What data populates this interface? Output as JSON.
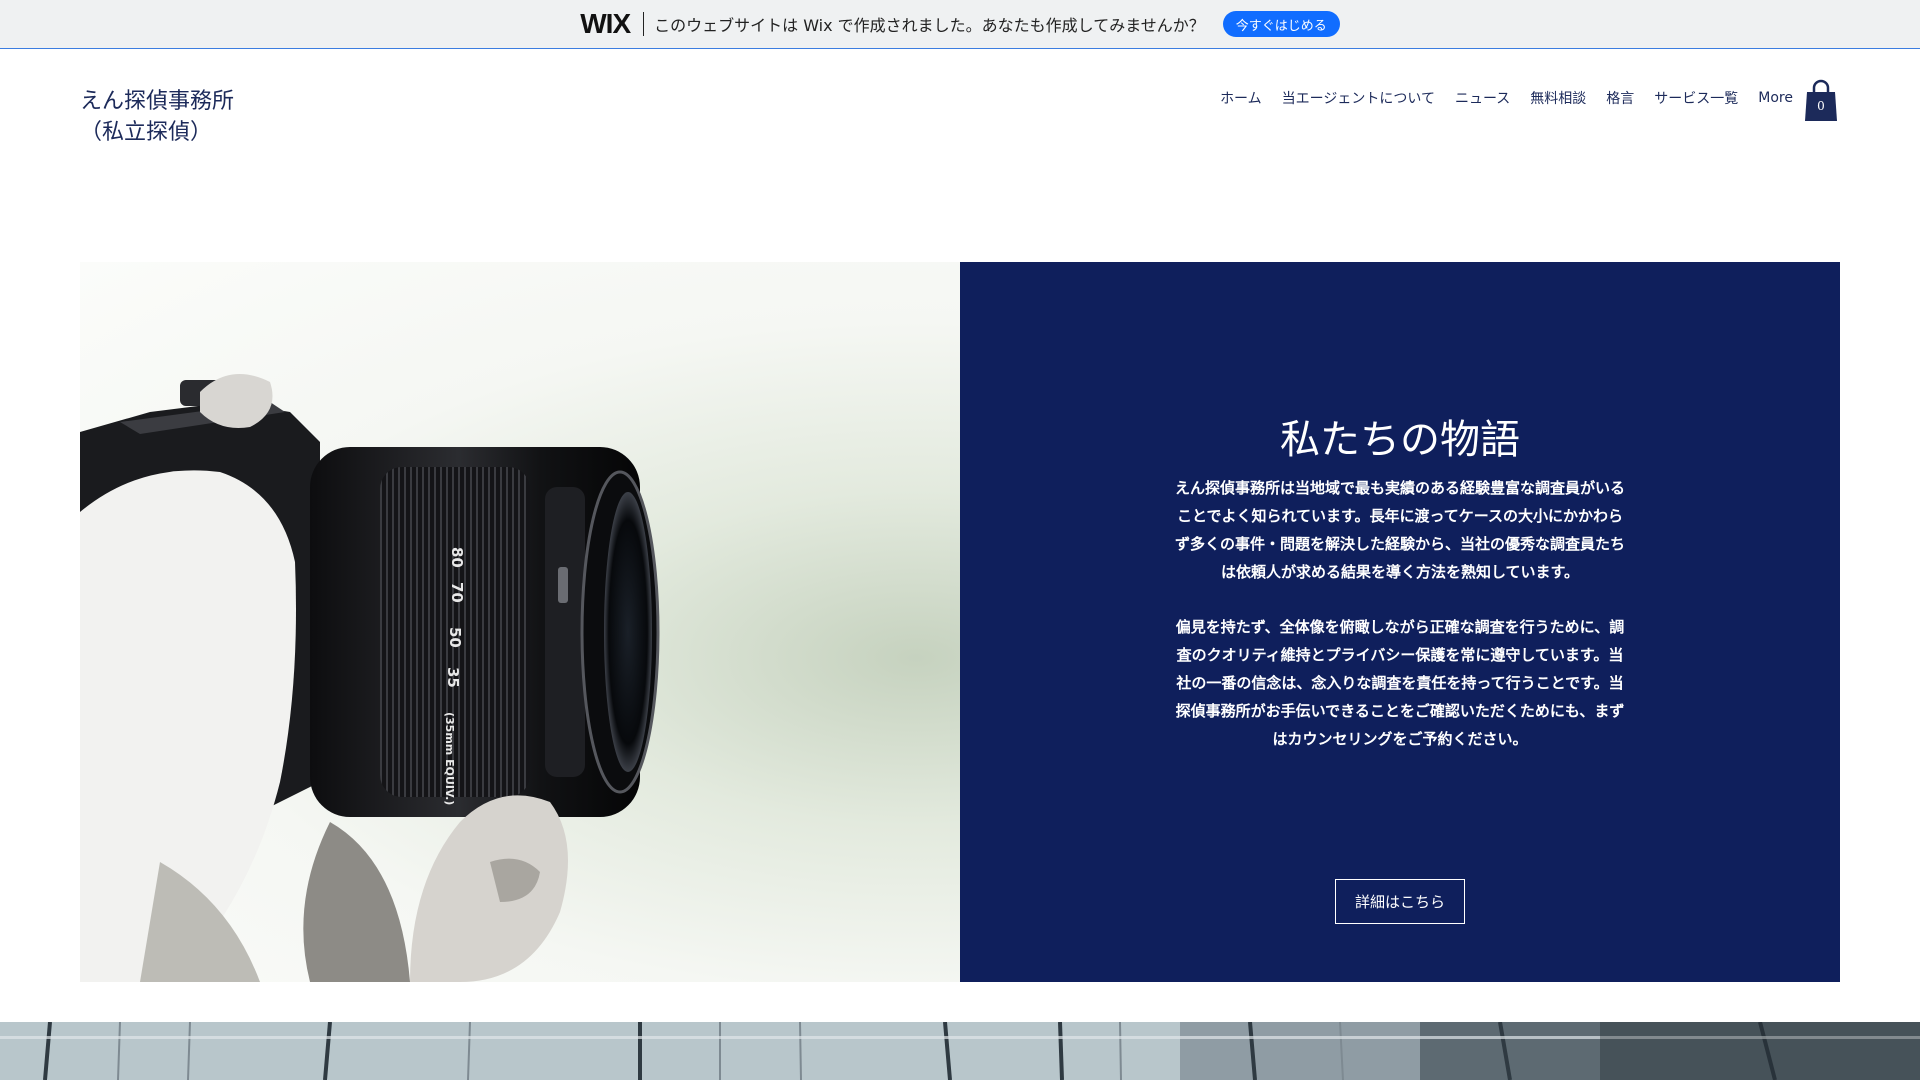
{
  "wix_banner": {
    "logo": "WIX",
    "text": "このウェブサイトは Wix で作成されました。あなたも作成してみませんか？",
    "cta_label": "今すぐはじめる",
    "cta_color": "#116dff"
  },
  "header": {
    "site_title_line1": "えん探偵事務所",
    "site_title_line2": "（私立探偵）",
    "nav": [
      {
        "label": "ホーム"
      },
      {
        "label": "当エージェントについて"
      },
      {
        "label": "ニュース"
      },
      {
        "label": "無料相談"
      },
      {
        "label": "格言"
      },
      {
        "label": "サービス一覧"
      },
      {
        "label": "More"
      }
    ],
    "cart_count": "0"
  },
  "hero": {
    "image_icon": "camera-photo",
    "lens_markings": [
      "80",
      "70",
      "50",
      "35",
      "(35mm EQUIV.)"
    ]
  },
  "story": {
    "title": "私たちの物語",
    "paragraph1": "えん探偵事務所は当地域で最も実績のある経験豊富な調査員がいることでよく知られています。長年に渡ってケースの大小にかかわらず多くの事件・問題を解決した経験から、当社の優秀な調査員たちは依頼人が求める結果を導く方法を熟知しています。",
    "paragraph2": "偏見を持たず、全体像を俯瞰しながら正確な調査を行うために、調査のクオリティ維持とプライバシー保護を常に遵守しています。当社の一番の信念は、念入りな調査を責任を持って行うことです。当探偵事務所がお手伝いできることをご確認いただくためにも、まずはカウンセリングをご予約ください。",
    "button_label": "詳細はこちら",
    "panel_color": "#0f1f5c"
  },
  "colors": {
    "brand_navy": "#1c2a5a",
    "banner_bg": "#eff1f2"
  }
}
